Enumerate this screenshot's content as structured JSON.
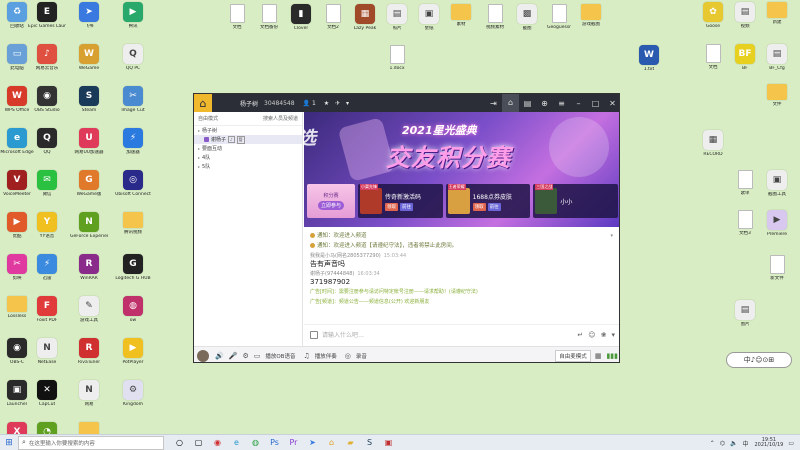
{
  "colors": {
    "desktop_bg": "#d8edc4",
    "titlebar_bg": "#2b2e36",
    "accent_purple": "#8a5ac8",
    "system_msg": "#6a7a3a",
    "ad_text": "#8ab03a"
  },
  "desktop_icons_left": [
    {
      "label": "回收站",
      "icon": "recycle-bin-icon",
      "color": "#5aa0e0",
      "glyph": "♻"
    },
    {
      "label": "Epic Games Launcher",
      "icon": "epic-icon",
      "color": "#222222",
      "glyph": "E"
    },
    {
      "label": "飞书",
      "icon": "feishu-icon",
      "color": "#3a7ae0",
      "glyph": "➤"
    },
    {
      "label": "腾讯",
      "icon": "play-icon",
      "color": "#28a86a",
      "glyph": "▶"
    },
    {
      "label": "此电脑",
      "icon": "computer-icon",
      "color": "#6aa0d8",
      "glyph": "▭"
    },
    {
      "label": "网易云音乐",
      "icon": "music-icon",
      "color": "#e05040",
      "glyph": "♪"
    },
    {
      "label": "WeGame",
      "icon": "wegame-icon",
      "color": "#d8a030",
      "glyph": "W"
    },
    {
      "label": "QQ PC",
      "icon": "qq-pc-icon",
      "color": "#eeeeee",
      "glyph": "Q"
    },
    {
      "label": "WPS Office",
      "icon": "wps-icon",
      "color": "#d83a2a",
      "glyph": "W"
    },
    {
      "label": "OBS Studio",
      "icon": "obs-icon",
      "color": "#333333",
      "glyph": "◉"
    },
    {
      "label": "Steam",
      "icon": "steam-icon",
      "color": "#1a3a5a",
      "glyph": "S"
    },
    {
      "label": "Image Cut",
      "icon": "image-cut-icon",
      "color": "#4a8ad0",
      "glyph": "✂"
    },
    {
      "label": "Microsoft Edge",
      "icon": "edge-icon",
      "color": "#2a9ad0",
      "glyph": "e"
    },
    {
      "label": "QQ",
      "icon": "qq-icon",
      "color": "#2a2a2a",
      "glyph": "Q"
    },
    {
      "label": "网易UU加速器",
      "icon": "uu-icon",
      "color": "#e03a5a",
      "glyph": "U"
    },
    {
      "label": "加速器",
      "icon": "booster-icon",
      "color": "#2a7ae0",
      "glyph": "⚡"
    },
    {
      "label": "VoiceMeeter",
      "icon": "voice-icon",
      "color": "#a02020",
      "glyph": "V"
    },
    {
      "label": "微信",
      "icon": "wechat-icon",
      "color": "#2ac040",
      "glyph": "✉"
    },
    {
      "label": "WeGame版",
      "icon": "game-icon",
      "color": "#e07a2a",
      "glyph": "G"
    },
    {
      "label": "Ubisoft Connect",
      "icon": "ubisoft-icon",
      "color": "#2a2a8a",
      "glyph": "◎"
    },
    {
      "label": "优酷",
      "icon": "youku-icon",
      "color": "#e05a2a",
      "glyph": "▶"
    },
    {
      "label": "YY语音",
      "icon": "yy-icon",
      "color": "#f0c020",
      "glyph": "Y"
    },
    {
      "label": "GeForce Experience",
      "icon": "nvidia-icon",
      "color": "#60a020",
      "glyph": "N"
    },
    {
      "label": "腾讯视频",
      "icon": "folder-icon",
      "color": "#f4c54a",
      "glyph": ""
    },
    {
      "label": "剪映",
      "icon": "jianying-icon",
      "color": "#e03aa0",
      "glyph": "✂"
    },
    {
      "label": "迅雷",
      "icon": "xunlei-icon",
      "color": "#3a8ae0",
      "glyph": "⚡"
    },
    {
      "label": "WinRAR",
      "icon": "winrar-icon",
      "color": "#8a2a8a",
      "glyph": "R"
    },
    {
      "label": "Logitech G HUB",
      "icon": "logitech-icon",
      "color": "#222222",
      "glyph": "G"
    },
    {
      "label": "Lossless",
      "icon": "folder-icon",
      "color": "#f4c54a",
      "glyph": ""
    },
    {
      "label": "Foxit PDF",
      "icon": "foxit-icon",
      "color": "#e03a3a",
      "glyph": "F"
    },
    {
      "label": "游戏工具",
      "icon": "tool-icon",
      "color": "#eeeeee",
      "glyph": "✎"
    },
    {
      "label": "ow",
      "icon": "ow-icon",
      "color": "#c0306a",
      "glyph": "◍"
    },
    {
      "label": "OBS-C",
      "icon": "obs-c-icon",
      "color": "#2a2a2a",
      "glyph": "◉"
    },
    {
      "label": "NetEase",
      "icon": "netease-icon",
      "color": "#eeeeee",
      "glyph": "N"
    },
    {
      "label": "RivaTuner",
      "icon": "rivatuner-icon",
      "color": "#d03030",
      "glyph": "R"
    },
    {
      "label": "PotPlayer",
      "icon": "potplayer-icon",
      "color": "#f0c020",
      "glyph": "▶"
    },
    {
      "label": "Launcher",
      "icon": "launcher-icon",
      "color": "#2a2a2a",
      "glyph": "▣"
    },
    {
      "label": "CapCut",
      "icon": "capcut-icon",
      "color": "#111111",
      "glyph": "✕"
    },
    {
      "label": "网易",
      "icon": "netease-music-icon",
      "color": "#eeeeee",
      "glyph": "N"
    },
    {
      "label": "Kingdom",
      "icon": "kingdom-icon",
      "color": "#e0e0f0",
      "glyph": "⚙"
    },
    {
      "label": "Xbox",
      "icon": "xbox-icon",
      "color": "#e03a5a",
      "glyph": "X"
    },
    {
      "label": "Xbox Game",
      "icon": "xbox-game-icon",
      "color": "#60a020",
      "glyph": "◔"
    },
    {
      "label": "音乐文件夹",
      "icon": "folder-icon",
      "color": "#f4c54a",
      "glyph": ""
    }
  ],
  "desktop_icons_top": [
    {
      "label": "文档",
      "icon": "doc-icon",
      "color": "#ffffff",
      "glyph": ""
    },
    {
      "label": "文档备份",
      "icon": "doc-icon",
      "color": "#ffffff",
      "glyph": ""
    },
    {
      "label": "Clover",
      "icon": "game-file-icon",
      "color": "#2a2a2a",
      "glyph": "▮"
    },
    {
      "label": "文档2",
      "icon": "doc-icon",
      "color": "#ffffff",
      "glyph": ""
    },
    {
      "label": "Lazy Peak",
      "icon": "game-file-icon",
      "color": "#a04a2a",
      "glyph": "▦"
    },
    {
      "label": "照片",
      "icon": "image-icon",
      "color": "#eeeeee",
      "glyph": "▤"
    },
    {
      "label": "壁纸",
      "icon": "image-icon",
      "color": "#eeeeee",
      "glyph": "▣"
    },
    {
      "label": "素材",
      "icon": "folder-icon",
      "color": "#f4c54a",
      "glyph": ""
    },
    {
      "label": "视频素材",
      "icon": "doc-icon",
      "color": "#ffffff",
      "glyph": ""
    },
    {
      "label": "截图",
      "icon": "image-icon",
      "color": "#eeeeee",
      "glyph": "▩"
    },
    {
      "label": "Geoguessr",
      "icon": "doc-icon",
      "color": "#ffffff",
      "glyph": ""
    },
    {
      "label": "游戏截图",
      "icon": "folder-icon",
      "color": "#f4c54a",
      "glyph": ""
    },
    {
      "label": "1.docx",
      "icon": "doc-icon",
      "color": "#ffffff",
      "glyph": ""
    },
    {
      "label": "1.txt",
      "icon": "word-icon",
      "color": "#2a5ab0",
      "glyph": "W"
    }
  ],
  "desktop_icons_right": [
    {
      "label": "Goose",
      "icon": "goose-icon",
      "color": "#e8c830",
      "glyph": "✿"
    },
    {
      "label": "视频",
      "icon": "video-icon",
      "color": "#eeeeee",
      "glyph": "▤"
    },
    {
      "label": "新建",
      "icon": "folder-icon",
      "color": "#f4c54a",
      "glyph": ""
    },
    {
      "label": "文档",
      "icon": "doc-icon",
      "color": "#ffffff",
      "glyph": ""
    },
    {
      "label": "BF",
      "icon": "bf-icon",
      "color": "#e8d020",
      "glyph": "BF"
    },
    {
      "label": "BF_Cfg",
      "icon": "file-icon",
      "color": "#eeeeee",
      "glyph": "▤"
    },
    {
      "label": "文件",
      "icon": "folder-icon",
      "color": "#f4c54a",
      "glyph": ""
    },
    {
      "label": "RECORD",
      "icon": "record-icon",
      "color": "#eeeeee",
      "glyph": "▦"
    },
    {
      "label": "歌单",
      "icon": "doc-icon",
      "color": "#ffffff",
      "glyph": ""
    },
    {
      "label": "截图工具",
      "icon": "snip-icon",
      "color": "#eeeeee",
      "glyph": "▣"
    },
    {
      "label": "文档3",
      "icon": "doc-icon",
      "color": "#ffffff",
      "glyph": ""
    },
    {
      "label": "Premiere",
      "icon": "premiere-icon",
      "color": "#d8c8f0",
      "glyph": "▶"
    },
    {
      "label": "新文件",
      "icon": "doc-icon",
      "color": "#ffffff",
      "glyph": ""
    },
    {
      "label": "图片",
      "icon": "image-icon",
      "color": "#eeeeee",
      "glyph": "▤"
    }
  ],
  "window": {
    "channel_name": "杨子树",
    "channel_id": "30484548",
    "user_count": "1",
    "sidebar": {
      "mode": "自由模式",
      "search_placeholder": "搜索人员及频道",
      "rows": [
        {
          "label": "杨子树",
          "indent": 4,
          "type": "channel"
        },
        {
          "label": "谢杨子",
          "indent": 10,
          "type": "user"
        },
        {
          "label": "要面互动",
          "indent": 4,
          "type": "channel"
        },
        {
          "label": "4队",
          "indent": 4,
          "type": "channel"
        },
        {
          "label": "5队",
          "indent": 4,
          "type": "channel"
        }
      ]
    },
    "banner": {
      "title": "2021星光盛典",
      "headline": "交友积分赛",
      "side_text": "选",
      "cards": [
        {
          "name": "积分赛",
          "cta": "立即参与"
        },
        {
          "name": "传奇新激活码",
          "tag": "小渠先锋",
          "btn1": "领取",
          "btn2": "前往",
          "thumb": "#b03a2a"
        },
        {
          "name": "1688点券皮肤",
          "tag": "王者荣耀",
          "btn1": "领取",
          "btn2": "前往",
          "thumb": "#d8a040"
        },
        {
          "name": "小小",
          "tag": "三国之战",
          "btn1": "",
          "btn2": "",
          "thumb": "#3a5a3a"
        }
      ]
    },
    "chat": {
      "sys1": "通知：欢迎进入频道",
      "sys2": "通知：欢迎进入频道【请遵纪守法】，违者将禁止此房间。",
      "msgs": [
        {
          "sender": "我我是小马(网名2805377290)",
          "time": "15:03:44",
          "body": "告有声音吗"
        },
        {
          "sender": "谢杨子(97444848)",
          "time": "16:03:34",
          "body": "371987902"
        }
      ],
      "ad1": "广告[时间]：需要注册参与请访问特定帐号注册——请求帮助！(请遵纪守法)",
      "ad2": "广告[频道]：频道公告——频道信息(公开) 欢迎新朋友"
    },
    "input_placeholder": "请输入什么吧…",
    "bottom": {
      "item1": "播放OB语音",
      "item2": "播放伴奏",
      "item3": "录音",
      "mode": "自由麦模式"
    }
  },
  "widget_text": "中♪☺⊙⊞",
  "taskbar": {
    "search_placeholder": "在这里输入你要搜索的内容",
    "time": "19:51",
    "date": "2021/10/19"
  }
}
